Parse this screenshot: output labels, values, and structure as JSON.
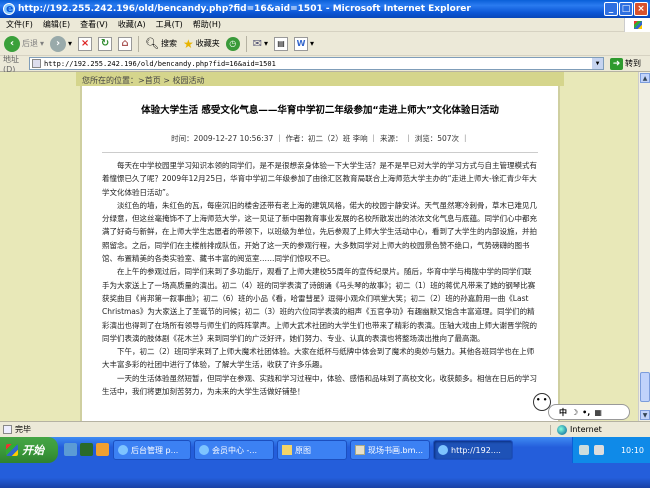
{
  "window": {
    "title": "http://192.255.242.196/old/bencandy.php?fid=16&aid=1501 - Microsoft Internet Explorer",
    "min": "_",
    "max": "□",
    "close": "×"
  },
  "menu": [
    "文件(F)",
    "编辑(E)",
    "查看(V)",
    "收藏(A)",
    "工具(T)",
    "帮助(H)"
  ],
  "toolbar": {
    "back": "后退",
    "search": "搜索",
    "favorites": "收藏夹"
  },
  "address": {
    "label": "地址(D)",
    "url": "http://192.255.242.196/old/bencandy.php?fid=16&aid=1501",
    "go": "转到"
  },
  "breadcrumb": {
    "prefix": "您所在的位置：",
    "home": ">首页",
    "sep": ">",
    "section": "校园活动"
  },
  "article": {
    "title": "体验大学生活 感受文化气息——华育中学初二年级参加“走进上师大”文化体验日活动",
    "meta": "时间：2009-12-27 10:56:37 ｜ 作者：初二（2）班 李响 ｜ 来源： ｜ 浏览：507次 ｜",
    "paragraphs": [
      "每天在中学校园里学习知识本领的同学们，是不是很想亲身体验一下大学生活？是不是早已对大学的学习方式与自主管理模式有着憧憬已久了呢？2009年12月25日，华育中学初二年级参加了由徐汇区教育局联合上海师范大学主办的“走进上师大-徐汇青少年大学文化体验日活动”。",
      "淡红色的墙，朱红色的瓦，每座沉旧的楼舍还带有老上海的建筑风格，偌大的校园宁静安详。天气虽然寒冷刺骨，草木已难见几分绿意，但这丝毫掩饰不了上海师范大学，这一见证了新中国教育事业发展的名校所散发出的浓浓文化气息与底蕴。同学们心中都充满了好奇与新鲜，在上师大学生志愿者的带领下，以班级为单位，先后参观了上师大学生活动中心，看到了大学生的内部设施，并拍照留念。之后，同学们在主楼前排成队伍，开始了这一天的参观行程，大多数同学对上师大的校园景色赞不绝口，气势磅礴的图书馆、布置精美的各类实验室、藏书丰富的阅览室……同学们惊叹不已。",
      "在上午的参观过后，同学们来到了多功能厅，观看了上师大建校55周年的宣传纪录片。随后，华育中学与梅陇中学的同学们联手为大家送上了一场高质量的演出。初二（4）班的同学表演了诗朗诵《马头琴的故事》；初二（1）班的蒋优凡带来了她的钢琴比赛获奖曲目《肖邦第一叙事曲》；初二（6）班的小品《看，哈雷彗星》逗得小观众们哄堂大笑；初二（2）班的孙嘉蔚用一曲《Last Christmas》为大家送上了圣诞节的问候；初二（3）班的六位同学表演的相声《五官争功》有趣幽默又饱含丰富道理。同学们的精彩演出也得到了在场所有领导与师生们的阵阵掌声。上师大武术社团的大学生们也带来了精彩的表演。压轴大戏由上师大谢晋学院的同学们表演的肢体剧《花木兰》来到同学们的广泛好评，她们努力、专业、认真的表演也将整场演出推向了最高潮。",
      "下午，初二（2）班同学来到了上师大魔术社团体验。大家在纸杯与纸牌中体会到了魔术的奥妙与魅力。其他各班同学也在上师大丰富多彩的社团中进行了体验，了解大学生活，收获了许多乐趣。",
      "一天的生活体验虽然短暂，但同学在参观、实践和学习过程中，体验、感悟和品味到了高校文化，收获颇多。相信在日后的学习生活中，我们将更加刻苦努力，为未来的大学生活做好铺垫！"
    ]
  },
  "status": {
    "done": "完毕",
    "zone": "Internet"
  },
  "ime": {
    "lang": "中",
    "punct": "•,"
  },
  "taskbar": {
    "start": "开始",
    "tasks": [
      "后台管理 p...",
      "会员中心 -...",
      "原图",
      "现场书画.bm...",
      "http://192...."
    ],
    "time": "10:10"
  },
  "colors": {
    "page_bg": "#e8e8b8",
    "crumb_bg": "#d5d58c",
    "taskbar": "#245edb",
    "start": "#3c9a3c"
  }
}
